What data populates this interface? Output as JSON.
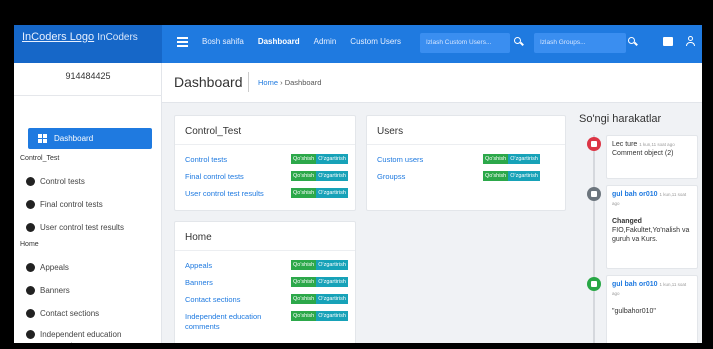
{
  "topbar": {
    "logo_alt": "InCoders Logo",
    "brand": "InCoders",
    "nav": [
      "Bosh sahifa",
      "Dashboard",
      "Admin",
      "Custom Users"
    ],
    "search_users_placeholder": "Izlash Custom Users...",
    "search_groups_placeholder": "Izlash Groups..."
  },
  "sidebar": {
    "user_id": "914484425",
    "active_item": "Dashboard",
    "section_control": "Control_Test",
    "control_items": [
      "Control tests",
      "Final control tests",
      "User control test results"
    ],
    "section_home": "Home",
    "home_items": [
      "Appeals",
      "Banners",
      "Contact sections",
      "Independent education comments"
    ]
  },
  "header": {
    "title": "Dashboard",
    "breadcrumb_home": "Home",
    "breadcrumb_sep": "›",
    "breadcrumb_current": "Dashboard"
  },
  "badges": {
    "add": "Qo'shish",
    "edit": "O'zgartirish"
  },
  "cards": {
    "control_test": {
      "title": "Control_Test",
      "rows": [
        "Control tests",
        "Final control tests",
        "User control test results"
      ]
    },
    "users": {
      "title": "Users",
      "rows": [
        "Custom users",
        "Groupss"
      ]
    },
    "home": {
      "title": "Home",
      "rows": [
        "Appeals",
        "Banners",
        "Contact sections",
        "Independent education comments"
      ]
    }
  },
  "timeline": {
    "title": "So'ngi harakatlar",
    "entries": [
      {
        "who": "Lec ture",
        "when": "1 kun,11 soat ago",
        "text": "Comment object (2)"
      },
      {
        "who": "gul bah or010",
        "when": "1 kun,11 soat ago",
        "action": "Changed",
        "text": "FIO,Fakultet,Yo'nalish va guruh va Kurs."
      },
      {
        "who": "gul bah or010",
        "when": "1 kun,11 soat ago",
        "text": "\"gulbahor010\""
      }
    ],
    "colors": [
      "#dc3545",
      "#6c757d",
      "#28a745"
    ]
  }
}
